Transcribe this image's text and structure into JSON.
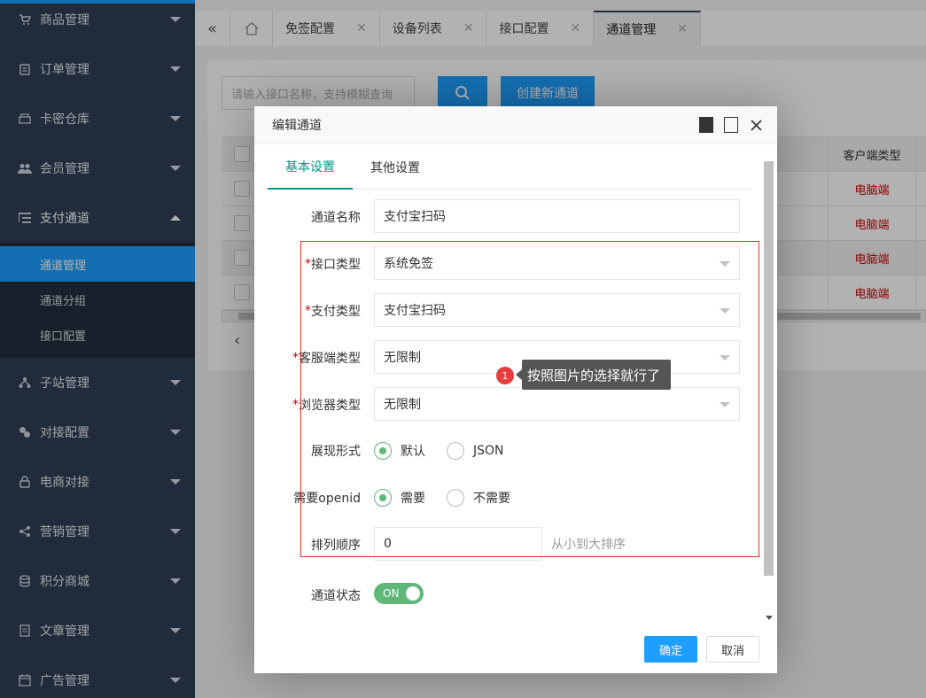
{
  "sidebar": {
    "items": [
      {
        "label": "商品管理",
        "icon": "cart-icon"
      },
      {
        "label": "订单管理",
        "icon": "clipboard-icon"
      },
      {
        "label": "卡密仓库",
        "icon": "storage-icon"
      },
      {
        "label": "会员管理",
        "icon": "users-icon"
      },
      {
        "label": "支付通道",
        "icon": "list-icon",
        "open": true
      },
      {
        "label": "子站管理",
        "icon": "sitemap-icon"
      },
      {
        "label": "对接配置",
        "icon": "link-icon"
      },
      {
        "label": "电商对接",
        "icon": "lock-icon"
      },
      {
        "label": "营销管理",
        "icon": "share-icon"
      },
      {
        "label": "积分商城",
        "icon": "database-icon"
      },
      {
        "label": "文章管理",
        "icon": "article-icon"
      },
      {
        "label": "广告管理",
        "icon": "ad-icon"
      }
    ],
    "sub_items": [
      "通道管理",
      "通道分组",
      "接口配置"
    ],
    "active_sub": "通道管理"
  },
  "tabbar": {
    "tabs": [
      "免签配置",
      "设备列表",
      "接口配置",
      "通道管理"
    ],
    "active": "通道管理"
  },
  "main": {
    "search_placeholder": "请输入接口名称，支持模糊查询",
    "create_label": "创建新通道",
    "table_header_client": "客户端类型",
    "rows": [
      "电脑端",
      "电脑端",
      "电脑端",
      "电脑端"
    ]
  },
  "modal": {
    "title": "编辑通道",
    "tabs": [
      "基本设置",
      "其他设置"
    ],
    "fields": {
      "channel_name_label": "通道名称",
      "channel_name_value": "支付宝扫码",
      "interface_type_label": "接口类型",
      "interface_type_value": "系统免签",
      "pay_type_label": "支付类型",
      "pay_type_value": "支付宝扫码",
      "client_type_label": "客服端类型",
      "client_type_value": "无限制",
      "browser_type_label": "浏览器类型",
      "browser_type_value": "无限制",
      "display_label": "展现形式",
      "display_opt_default": "默认",
      "display_opt_json": "JSON",
      "openid_label": "需要openid",
      "openid_opt_yes": "需要",
      "openid_opt_no": "不需要",
      "sort_label": "排列顺序",
      "sort_value": "0",
      "sort_hint": "从小到大排序",
      "status_label": "通道状态",
      "status_switch": "ON"
    },
    "required_mark": "*",
    "ok_label": "确定",
    "cancel_label": "取消"
  },
  "annotation": {
    "badge": "1",
    "text": "按照图片的选择就行了"
  }
}
